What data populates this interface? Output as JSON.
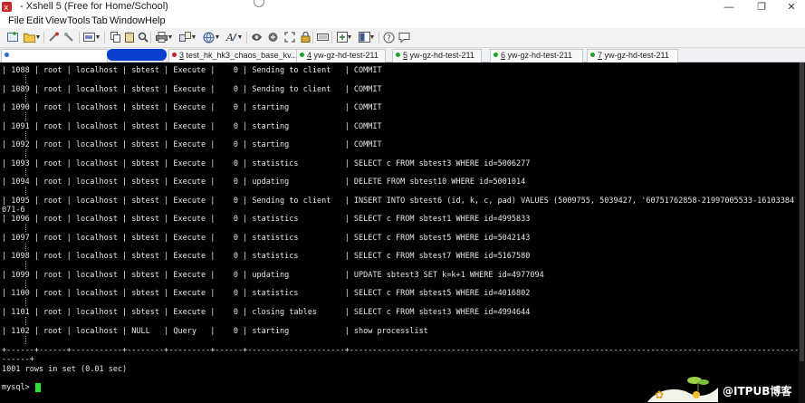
{
  "window": {
    "title": "- Xshell 5 (Free for Home/School)",
    "minimize": "—",
    "maximize": "❐",
    "close": "✕"
  },
  "menu": [
    "File",
    "Edit",
    "View",
    "Tools",
    "Tab",
    "Window",
    "Help"
  ],
  "tabs": [
    {
      "num": "",
      "label": ""
    },
    {
      "num": "3",
      "label": " test_hk_hk3_chaos_base_kv..."
    },
    {
      "num": "4",
      "label": " yw-gz-hd-test-211"
    },
    {
      "num": "5",
      "label": " yw-gz-hd-test-211"
    },
    {
      "num": "6",
      "label": " yw-gz-hd-test-211"
    },
    {
      "num": "7",
      "label": " yw-gz-hd-test-211"
    }
  ],
  "tab_add": "+",
  "terminal": {
    "rows": [
      "| 1088 | root | localhost | sbtest | Execute |    0 | Sending to client   | COMMIT",
      "| 1089 | root | localhost | sbtest | Execute |    0 | Sending to client   | COMMIT",
      "| 1090 | root | localhost | sbtest | Execute |    0 | starting            | COMMIT",
      "| 1091 | root | localhost | sbtest | Execute |    0 | starting            | COMMIT",
      "| 1092 | root | localhost | sbtest | Execute |    0 | starting            | COMMIT",
      "| 1093 | root | localhost | sbtest | Execute |    0 | statistics          | SELECT c FROM sbtest3 WHERE id=5006277",
      "| 1094 | root | localhost | sbtest | Execute |    0 | updating            | DELETE FROM sbtest10 WHERE id=5001014",
      "| 1095 | root | localhost | sbtest | Execute |    0 | Sending to client   | INSERT INTO sbtest6 (id, k, c, pad) VALUES (5009755, 5039427, '60751762858-21997005533-16103384",
      "| 1096 | root | localhost | sbtest | Execute |    0 | statistics          | SELECT c FROM sbtest1 WHERE id=4995833",
      "| 1097 | root | localhost | sbtest | Execute |    0 | statistics          | SELECT c FROM sbtest5 WHERE id=5042143",
      "| 1098 | root | localhost | sbtest | Execute |    0 | statistics          | SELECT c FROM sbtest7 WHERE id=5167580",
      "| 1099 | root | localhost | sbtest | Execute |    0 | updating            | UPDATE sbtest3 SET k=k+1 WHERE id=4977094",
      "| 1100 | root | localhost | sbtest | Execute |    0 | statistics          | SELECT c FROM sbtest5 WHERE id=4016802",
      "| 1101 | root | localhost | sbtest | Execute |    0 | closing tables      | SELECT c FROM sbtest3 WHERE id=4994644",
      "| 1102 | root | localhost | NULL   | Query   |    0 | starting            | show processlist"
    ],
    "wrap_fragment": "071-6",
    "separator": "+------+------+-----------+--------+---------+------+---------------------+--------------------------------------------------------------------------------------------------------",
    "separator_tail": "------+",
    "result": "1001 rows in set (0.01 sec)",
    "prompt": "mysql> "
  },
  "watermark": {
    "text": "@ITPUB博客"
  },
  "colors": {
    "terminal_bg": "#000000",
    "terminal_fg": "#e6e6e6",
    "cursor": "#2ee02e",
    "redaction": "#0a3fd0"
  }
}
